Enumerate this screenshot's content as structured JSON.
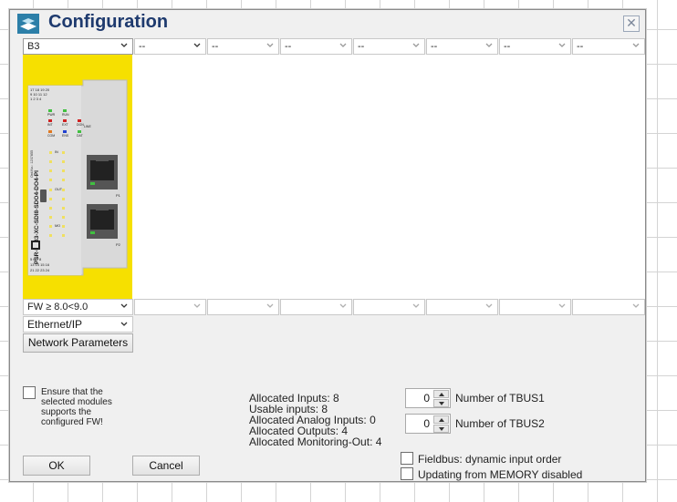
{
  "window": {
    "title": "Configuration"
  },
  "slots": {
    "selected": "B3",
    "empty_value": "--"
  },
  "firmware": {
    "selected": "FW ≥ 8.0<9.0"
  },
  "protocol": {
    "selected": "Ethernet/IP"
  },
  "buttons": {
    "network_parameters": "Network Parameters",
    "ok": "OK",
    "cancel": "Cancel"
  },
  "ensure": {
    "label": "Ensure that the selected modules supports the configured FW!",
    "checked": false
  },
  "allocation": {
    "inputs": "Allocated Inputs: 8",
    "usable_inputs": "Usable inputs: 8",
    "analog_inputs": "Allocated Analog Inputs: 0",
    "outputs": "Allocated Outputs: 4",
    "monitoring_out": "Allocated Monitoring-Out: 4"
  },
  "tbus": {
    "tbus1_value": "0",
    "tbus1_label": "Number of TBUS1",
    "tbus2_value": "0",
    "tbus2_label": "Number of TBUS2"
  },
  "options": {
    "fieldbus_label": "Fieldbus: dynamic input order",
    "fieldbus_checked": false,
    "memory_label": "Updating from MEMORY disabled",
    "memory_checked": false
  },
  "module": {
    "name": "PSR-M-B3-XC-SDI8-SDO4-DO4-PI",
    "order_no": "Ord.No.: 1237855",
    "top_terminals": [
      "17 18 19 20",
      "9 10 11 12",
      "1 2 3 4"
    ],
    "bottom_terminals": [
      "5 6 7 8",
      "13 14 15 16",
      "21 22 23 24"
    ],
    "leds": [
      "PWR",
      "RUN",
      "INT",
      "EXT",
      "DGN",
      "LINE",
      "COM",
      "ENS",
      "DAT"
    ],
    "io_labels": [
      "IN",
      "OUT",
      "MO"
    ],
    "ports": [
      "P1",
      "P2"
    ]
  },
  "colors": {
    "module_yellow": "#f6e000",
    "title_blue": "#1e3a6e",
    "dialog_bg": "#f0f0f0"
  }
}
